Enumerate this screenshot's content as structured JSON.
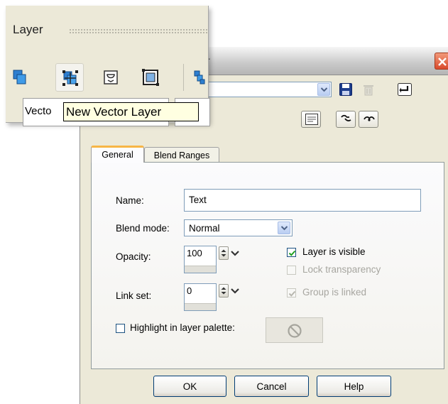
{
  "dialog": {
    "title_fragment": "r",
    "preset_value": "",
    "tabs": [
      {
        "label": "General"
      },
      {
        "label": "Blend Ranges"
      }
    ],
    "name_label": "Name:",
    "name_value": "Text",
    "blend_mode_label": "Blend mode:",
    "blend_mode_value": "Normal",
    "opacity_label": "Opacity:",
    "opacity_value": "100",
    "link_set_label": "Link set:",
    "link_set_value": "0",
    "layer_visible_label": "Layer is visible",
    "layer_visible_checked": true,
    "lock_transparency_label": "Lock transparency",
    "lock_transparency_checked": false,
    "group_linked_label": "Group is linked",
    "group_linked_checked": true,
    "highlight_label": "Highlight in layer palette:",
    "highlight_checked": false,
    "ok_label": "OK",
    "cancel_label": "Cancel",
    "help_label": "Help"
  },
  "palette": {
    "title": "Layer",
    "layer_cell_text": "Vecto",
    "tooltip": "New Vector Layer"
  },
  "colors": {
    "dialog_bg": "#ece9d8",
    "tab_highlight": "#f7b646",
    "tooltip_bg": "#ffffe1",
    "checkmark": "#21a121",
    "close_button": "#d9492b"
  },
  "icons": [
    "new-raster-layer-icon",
    "new-vector-layer-icon",
    "new-mask-layer-icon",
    "new-adjustment-layer-icon",
    "layer-properties-icon",
    "save-preset-icon",
    "delete-preset-icon",
    "reset-icon",
    "properties-icon",
    "layer-options-icon",
    "edit-layer-icon",
    "no-color-icon"
  ]
}
